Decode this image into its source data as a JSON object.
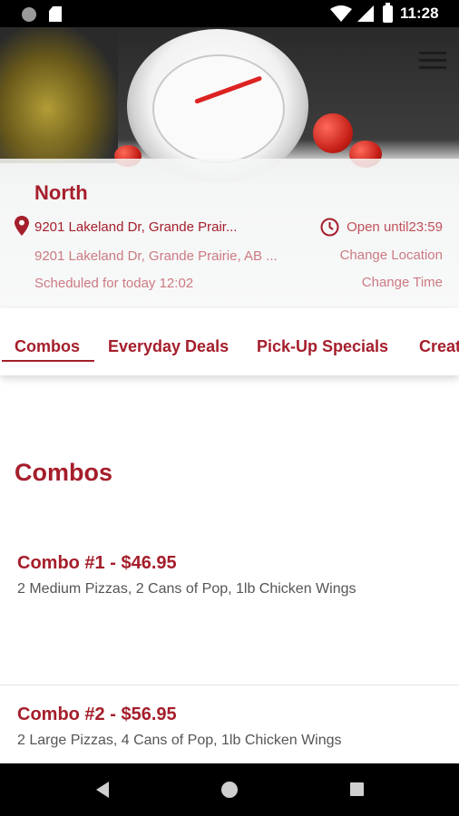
{
  "status_bar": {
    "time": "11:28"
  },
  "location": {
    "name": "North",
    "address_short": "9201 Lakeland Dr, Grande Prair...",
    "address_full": "9201 Lakeland Dr, Grande Prairie, AB ...",
    "scheduled": "Scheduled for today 12:02",
    "open_until": "Open until23:59",
    "change_location": "Change Location",
    "change_time": "Change Time"
  },
  "tabs": [
    {
      "label": "Combos"
    },
    {
      "label": "Everyday Deals"
    },
    {
      "label": "Pick-Up Specials"
    },
    {
      "label": "Creat"
    }
  ],
  "section": {
    "heading": "Combos"
  },
  "items": [
    {
      "title": "Combo #1 - $46.95",
      "description": "2 Medium Pizzas, 2 Cans of Pop, 1lb Chicken Wings"
    },
    {
      "title": "Combo #2 - $56.95",
      "description": "2 Large Pizzas, 4 Cans of Pop, 1lb Chicken Wings"
    }
  ],
  "colors": {
    "accent": "#a51e2b",
    "muted_accent": "#cc7a82"
  }
}
